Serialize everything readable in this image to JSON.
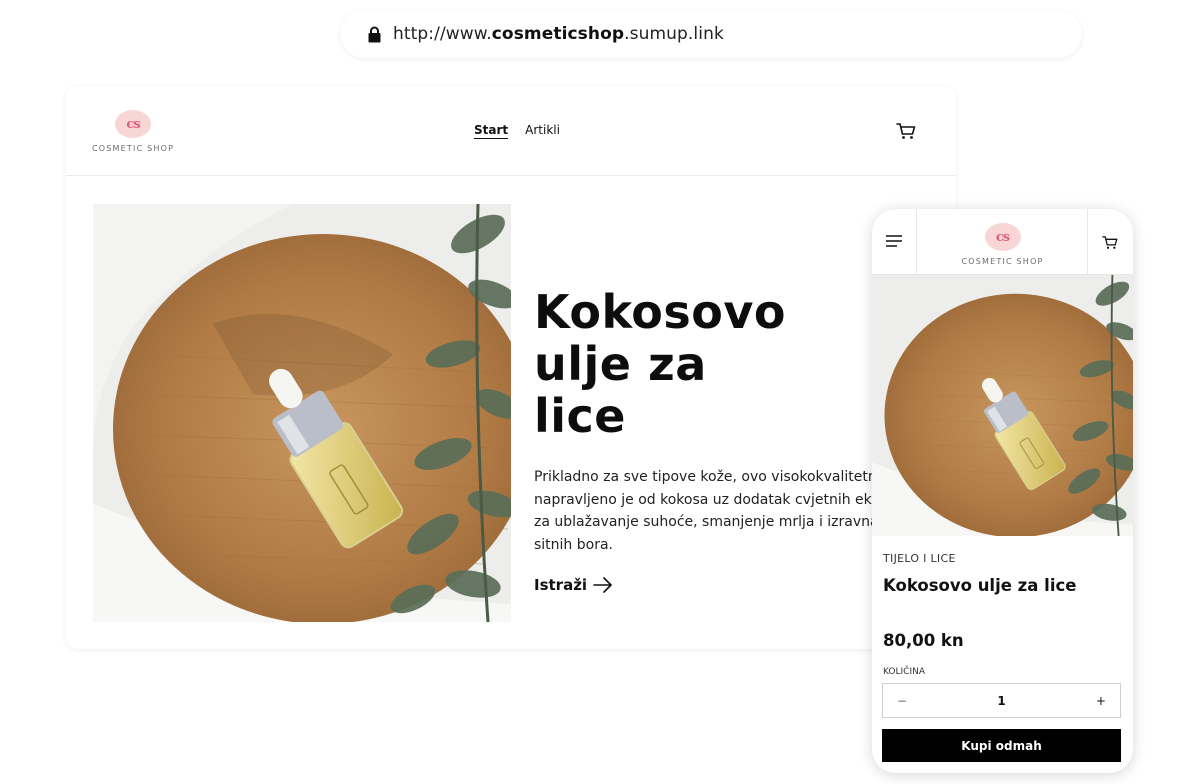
{
  "browser": {
    "url_prefix": "http://www.",
    "url_domain": "cosmeticshop",
    "url_suffix": ".sumup.link"
  },
  "brand": {
    "logo_mark": "cs",
    "name": "COSMETIC SHOP",
    "accent_pink": "#f8d6d6",
    "logo_text_color": "#e0607a"
  },
  "nav": {
    "items": [
      {
        "label": "Start",
        "active": true
      },
      {
        "label": "Artikli",
        "active": false
      }
    ]
  },
  "hero": {
    "title_line1": "Kokosovo",
    "title_line2": "ulje za lice",
    "description": "Prikladno za sve tipove kože, ovo visokokvalitetno ulje napravljeno je od kokosa uz dodatak cvjetnih ekstrakata za ublažavanje suhoće, smanjenje mrlja i izravnavanje sitnih bora.",
    "cta_label": "Istraži",
    "image": "dropper-bottle-on-wooden-board-with-eucalyptus"
  },
  "mobile": {
    "category": "TIJELO I LICE",
    "product_title": "Kokosovo ulje za lice",
    "price": "80,00 kn",
    "quantity_label": "KOLIČINA",
    "quantity_value": "1",
    "minus_label": "−",
    "plus_label": "+",
    "buy_label": "Kupi odmah"
  },
  "icons": {
    "lock": "lock-icon",
    "cart": "shopping-cart-icon",
    "menu": "hamburger-menu-icon",
    "arrow": "arrow-right-icon"
  }
}
